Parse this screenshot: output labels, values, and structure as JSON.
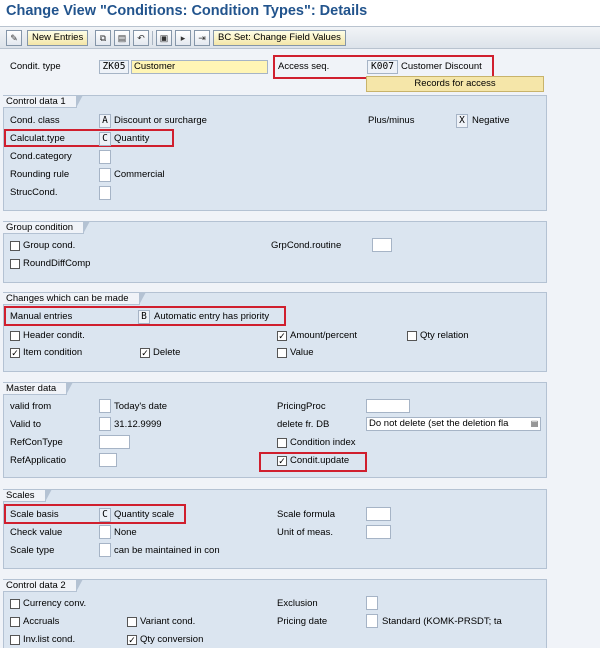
{
  "title": "Change View \"Conditions: Condition Types\": Details",
  "toolbar": {
    "new_entries": "New Entries",
    "bc_set": "BC Set: Change Field Values"
  },
  "header": {
    "condit_type_label": "Condit. type",
    "condit_type_code": "ZK05",
    "condit_type_name": "Customer",
    "access_seq_label": "Access seq.",
    "access_seq_code": "K007",
    "access_seq_name": "Customer Discount",
    "records_btn": "Records for access"
  },
  "control1": {
    "title": "Control data 1",
    "cond_class_label": "Cond. class",
    "cond_class_code": "A",
    "cond_class_text": "Discount or surcharge",
    "plusminus_label": "Plus/minus",
    "plusminus_code": "X",
    "plusminus_text": "Negative",
    "calc_type_label": "Calculat.type",
    "calc_type_code": "C",
    "calc_type_text": "Quantity",
    "cond_category_label": "Cond.category",
    "rounding_label": "Rounding rule",
    "rounding_text": "Commercial",
    "struc_label": "StrucCond."
  },
  "group_cond": {
    "title": "Group condition",
    "group_cond_label": "Group cond.",
    "grpcond_routine_label": "GrpCond.routine",
    "round_diff_label": "RoundDiffComp"
  },
  "changes": {
    "title": "Changes which can be made",
    "manual_label": "Manual entries",
    "manual_code": "B",
    "manual_text": "Automatic entry has priority",
    "header_cond_label": "Header condit.",
    "amount_label": "Amount/percent",
    "qty_relation_label": "Qty relation",
    "item_cond_label": "Item condition",
    "delete_label": "Delete",
    "value_label": "Value"
  },
  "master": {
    "title": "Master data",
    "valid_from_label": "valid from",
    "valid_from_text": "Today's date",
    "pricing_proc_label": "PricingProc",
    "valid_to_label": "Valid to",
    "valid_to_text": "31.12.9999",
    "delete_fr_label": "delete fr. DB",
    "delete_fr_value": "Do not delete (set the deletion fla",
    "refcontype_label": "RefConType",
    "cond_index_label": "Condition index",
    "refapp_label": "RefApplicatio",
    "condit_update_label": "Condit.update"
  },
  "scales": {
    "title": "Scales",
    "scale_basis_label": "Scale basis",
    "scale_basis_code": "C",
    "scale_basis_text": "Quantity scale",
    "scale_formula_label": "Scale formula",
    "check_value_label": "Check value",
    "check_value_text": "None",
    "unit_label": "Unit of meas.",
    "scale_type_label": "Scale type",
    "scale_type_text": "can be maintained in con"
  },
  "control2": {
    "title": "Control data 2",
    "currency_label": "Currency conv.",
    "exclusion_label": "Exclusion",
    "accruals_label": "Accruals",
    "variant_label": "Variant cond.",
    "pricing_date_label": "Pricing date",
    "pricing_date_value": "Standard (KOMK-PRSDT; ta",
    "invlist_label": "Inv.list cond.",
    "qty_conv_label": "Qty conversion"
  },
  "checkbox_states": {
    "group_cond": false,
    "round_diff": false,
    "header_cond": false,
    "amount_percent": true,
    "qty_relation": false,
    "item_condition": true,
    "delete": true,
    "value": false,
    "condition_index": false,
    "condit_update": true,
    "currency_conv": false,
    "accruals": false,
    "variant_cond": false,
    "inv_list": false,
    "qty_conversion": true
  },
  "colors": {
    "title": "#22548d",
    "highlight": "#d01f2e",
    "group_bg": "#dbe5f0",
    "records_btn": "#f5e6a9"
  },
  "icons": {
    "toolbar": [
      "pencil-glasses-icon",
      "copy-icon",
      "save-icon",
      "undo-icon",
      "page-icon",
      "page-next-icon",
      "page-last-icon"
    ],
    "dropdown": "dropdown-icon"
  }
}
